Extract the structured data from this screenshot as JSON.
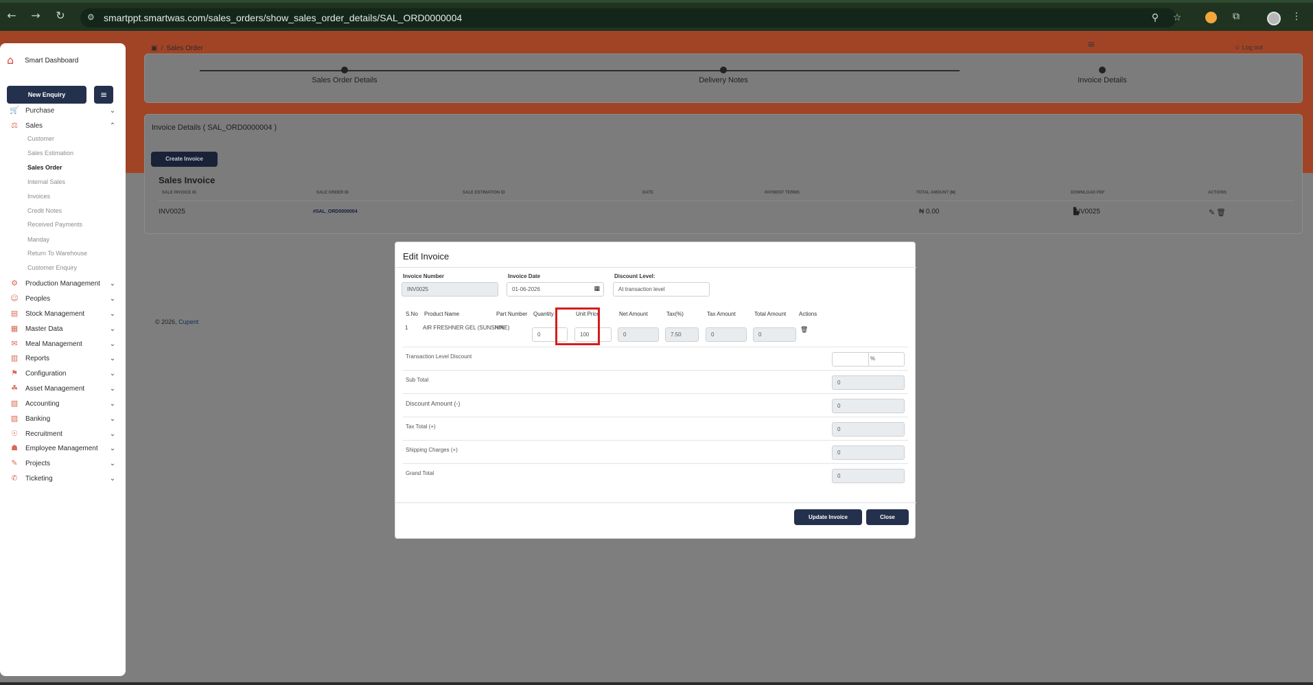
{
  "browser": {
    "url": "smartppt.smartwas.com/sales_orders/show_sales_order_details/SAL_ORD0000004",
    "back_icon": "←",
    "forward_icon": "→",
    "reload_icon": "↻",
    "zoom_icon": "⚲",
    "star_icon": "☆",
    "extensions_icon": "⧉",
    "menu_icon": "⋮"
  },
  "sidebar": {
    "brand": "Smart Dashboard",
    "new_enquiry": "New Enquiry",
    "menu_icon": "≡",
    "items": [
      {
        "label": "Purchase",
        "icon": "🛒",
        "chevron": "⌄"
      },
      {
        "label": "Sales",
        "icon": "⚖",
        "chevron": "⌃"
      },
      {
        "label": "Production Management",
        "icon": "⚙",
        "chevron": "⌄"
      },
      {
        "label": "Peoples",
        "icon": "☺",
        "chevron": "⌄"
      },
      {
        "label": "Stock Management",
        "icon": "▤",
        "chevron": "⌄"
      },
      {
        "label": "Master Data",
        "icon": "▦",
        "chevron": "⌄"
      },
      {
        "label": "Meal Management",
        "icon": "✉",
        "chevron": "⌄"
      },
      {
        "label": "Reports",
        "icon": "▥",
        "chevron": "⌄"
      },
      {
        "label": "Configuration",
        "icon": "⚑",
        "chevron": "⌄"
      },
      {
        "label": "Asset Management",
        "icon": "☘",
        "chevron": "⌄"
      },
      {
        "label": "Accounting",
        "icon": "▧",
        "chevron": "⌄"
      },
      {
        "label": "Banking",
        "icon": "▨",
        "chevron": "⌄"
      },
      {
        "label": "Recruitment",
        "icon": "☉",
        "chevron": "⌄"
      },
      {
        "label": "Employee Management",
        "icon": "☗",
        "chevron": "⌄"
      },
      {
        "label": "Projects",
        "icon": "✎",
        "chevron": "⌄"
      },
      {
        "label": "Ticketing",
        "icon": "✆",
        "chevron": "⌄"
      }
    ],
    "sales_subitems": [
      "Customer",
      "Sales Estimation",
      "Sales Order",
      "Internal Sales",
      "Invoices",
      "Credit Notes",
      "Received Payments",
      "Manday",
      "Return To Warehouse",
      "Customer Enquiry"
    ]
  },
  "header": {
    "breadcrumb_separator": "/",
    "breadcrumb": "Sales Order",
    "hamburger": "≡",
    "logout": "Log out"
  },
  "stepper": {
    "steps": [
      "Sales Order Details",
      "Delivery Notes",
      "Invoice Details"
    ]
  },
  "invoice_section": {
    "title": "Invoice Details ( SAL_ORD0000004 )",
    "create_button": "Create Invoice",
    "table_title": "Sales Invoice",
    "columns": [
      "SALE INVOICE ID",
      "SALE ORDER ID",
      "SALE ESTIMATION ID",
      "DATE",
      "PAYMENT TERMS",
      "TOTAL AMOUNT (₦)",
      "DOWNLOAD PDF",
      "ACTIONS"
    ],
    "row": {
      "invoice_id": "INV0025",
      "order_id": "#SAL_ORD0000004",
      "total": "₦ 0.00",
      "pdf": "INV0025",
      "pdf_icon": "▙",
      "edit_icon": "✎",
      "delete_icon": "🗑"
    }
  },
  "footer": {
    "text": "© 2026,",
    "brand": "Cupent"
  },
  "modal": {
    "title": "Edit Invoice",
    "invoice_number_label": "Invoice Number",
    "invoice_number": "INV0025",
    "invoice_date_label": "Invoice Date",
    "invoice_date": "01-06-2026",
    "discount_level_label": "Discount Level:",
    "discount_level": "At transaction level",
    "columns": [
      "S.No",
      "Product Name",
      "Part Number",
      "Quantity",
      "Unit Price",
      "Net Amount",
      "Tax(%)",
      "Tax Amount",
      "Total Amount",
      "Actions"
    ],
    "line": {
      "sno": "1",
      "product": "AIR FRESHNER GEL (SUNSHINE)",
      "part_number": "N/A",
      "quantity": "0",
      "unit_price": "100",
      "net_amount": "0",
      "tax": "7.50",
      "tax_amount": "0",
      "total_amount": "0",
      "delete_icon": "🗑"
    },
    "summary": {
      "transaction_discount_label": "Transaction Level Discount",
      "percent_symbol": "%",
      "subtotal_label": "Sub Total",
      "subtotal": "0",
      "discount_label": "Discount Amount (-)",
      "discount": "0",
      "tax_total_label": "Tax Total (+)",
      "tax_total": "0",
      "shipping_label": "Shipping Charges (+)",
      "shipping": "0",
      "grand_total_label": "Grand Total",
      "grand_total": "0"
    },
    "update_button": "Update Invoice",
    "close_button": "Close",
    "calendar_icon": "▦"
  }
}
